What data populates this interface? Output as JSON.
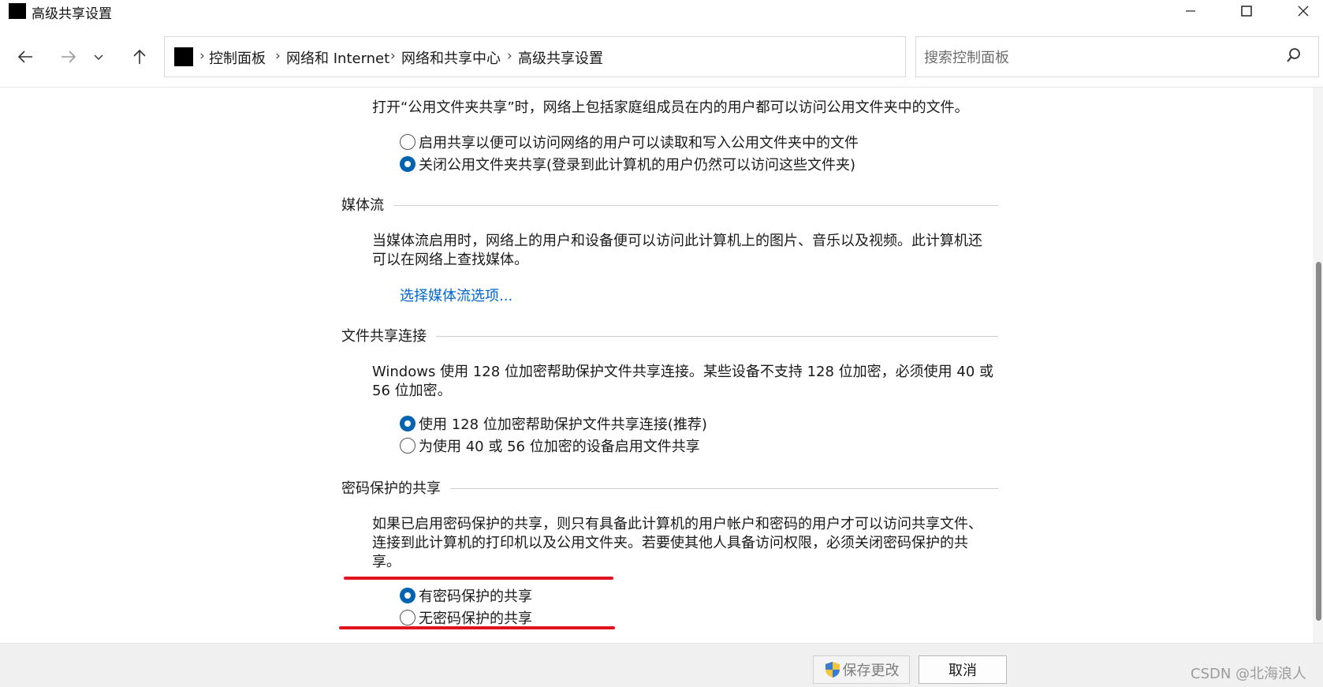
{
  "window": {
    "title": "高级共享设置"
  },
  "nav": {
    "breadcrumb": [
      "控制面板",
      "网络和 Internet",
      "网络和共享中心",
      "高级共享设置"
    ],
    "search_placeholder": "搜索控制面板"
  },
  "public_folder": {
    "description": "打开“公用文件夹共享”时，网络上包括家庭组成员在内的用户都可以访问公用文件夹中的文件。",
    "options": [
      {
        "label": "启用共享以便可以访问网络的用户可以读取和写入公用文件夹中的文件",
        "checked": false
      },
      {
        "label": "关闭公用文件夹共享(登录到此计算机的用户仍然可以访问这些文件夹)",
        "checked": true
      }
    ]
  },
  "media_streaming": {
    "title": "媒体流",
    "description_line1": "当媒体流启用时，网络上的用户和设备便可以访问此计算机上的图片、音乐以及视频。此计算机还",
    "description_line2": "可以在网络上查找媒体。",
    "link": "选择媒体流选项..."
  },
  "file_sharing": {
    "title": "文件共享连接",
    "description_line1": "Windows 使用 128 位加密帮助保护文件共享连接。某些设备不支持 128 位加密，必须使用 40 或",
    "description_line2": "56 位加密。",
    "options": [
      {
        "label": "使用 128 位加密帮助保护文件共享连接(推荐)",
        "checked": true
      },
      {
        "label": "为使用 40 或 56 位加密的设备启用文件共享",
        "checked": false
      }
    ]
  },
  "password_sharing": {
    "title": "密码保护的共享",
    "description_line1": "如果已启用密码保护的共享，则只有具备此计算机的用户帐户和密码的用户才可以访问共享文件、",
    "description_line2": "连接到此计算机的打印机以及公用文件夹。若要使其他人具备访问权限，必须关闭密码保护的共",
    "description_line3": "享。",
    "options": [
      {
        "label": "有密码保护的共享",
        "checked": true
      },
      {
        "label": "无密码保护的共享",
        "checked": false
      }
    ]
  },
  "footer": {
    "save_label": "保存更改",
    "cancel_label": "取消",
    "watermark": "CSDN @北海浪人"
  },
  "colors": {
    "accent": "#0063b1",
    "link": "#0066cc",
    "annotation_red": "#e0141e"
  }
}
